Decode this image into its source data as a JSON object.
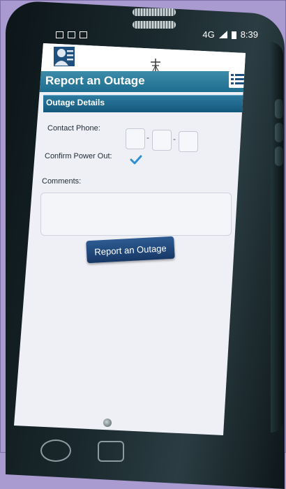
{
  "status_bar": {
    "network": "4G",
    "time": "8:39"
  },
  "page": {
    "title": "Report an Outage"
  },
  "form": {
    "section_title": "Outage Details",
    "contact_phone_label": "Contact Phone:",
    "confirm_power_label": "Confirm Power Out:",
    "comments_label": "Comments:",
    "phone_separator": "-",
    "submit_label": "Report an Outage"
  },
  "colors": {
    "accent": "#1f6d8f",
    "button": "#1f4475",
    "check": "#2f8fd0",
    "background": "#a99ad0"
  }
}
